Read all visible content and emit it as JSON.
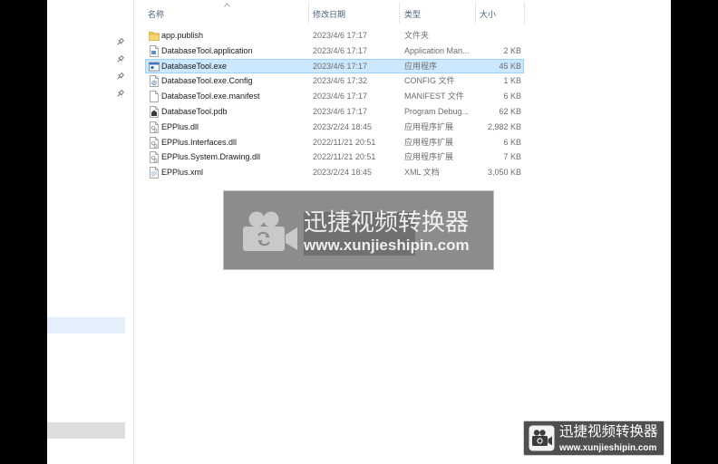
{
  "theme": {
    "selection-fill": "#cce8ff",
    "selection-border": "#99d1ff",
    "header-text": "#4c607a",
    "nav-highlight": "#e3f0fb",
    "nav-scroll-band": "#dedede"
  },
  "nav_pane": {
    "pins": [
      {
        "icon": "pin-icon"
      },
      {
        "icon": "pin-icon"
      },
      {
        "icon": "pin-icon"
      },
      {
        "icon": "pin-icon"
      }
    ]
  },
  "file_list": {
    "columns": {
      "name": "名称",
      "modified": "修改日期",
      "type": "类型",
      "size": "大小"
    },
    "sort_icon": "sort-ascending-icon",
    "files": [
      {
        "name": "app.publish",
        "modified": "2023/4/6 17:17",
        "type": "文件夹",
        "icon": "folder-icon"
      },
      {
        "name": "DatabaseTool.application",
        "modified": "2023/4/6 17:17",
        "type": "Application Man...",
        "size": "2 KB",
        "icon": "application-file-icon"
      },
      {
        "name": "DatabaseTool.exe",
        "modified": "2023/4/6 17:17",
        "type": "应用程序",
        "size": "45 KB",
        "icon": "exe-icon",
        "selected": true
      },
      {
        "name": "DatabaseTool.exe.Config",
        "modified": "2023/4/6 17:32",
        "type": "CONFIG 文件",
        "size": "1 KB",
        "icon": "config-file-icon"
      },
      {
        "name": "DatabaseTool.exe.manifest",
        "modified": "2023/4/6 17:17",
        "type": "MANIFEST 文件",
        "size": "6 KB",
        "icon": "manifest-file-icon"
      },
      {
        "name": "DatabaseTool.pdb",
        "modified": "2023/4/6 17:17",
        "type": "Program Debug...",
        "size": "62 KB",
        "icon": "pdb-file-icon"
      },
      {
        "name": "EPPlus.dll",
        "modified": "2023/2/24 18:45",
        "type": "应用程序扩展",
        "size": "2,982 KB",
        "icon": "dll-file-icon"
      },
      {
        "name": "EPPlus.Interfaces.dll",
        "modified": "2022/11/21 20:51",
        "type": "应用程序扩展",
        "size": "6 KB",
        "icon": "dll-file-icon"
      },
      {
        "name": "EPPlus.System.Drawing.dll",
        "modified": "2022/11/21 20:51",
        "type": "应用程序扩展",
        "size": "7 KB",
        "icon": "dll-file-icon"
      },
      {
        "name": "EPPlus.xml",
        "modified": "2023/2/24 18:45",
        "type": "XML 文档",
        "size": "3,050 KB",
        "icon": "xml-file-icon"
      }
    ]
  },
  "watermark": {
    "title": "迅捷视频转换器",
    "url": "www.xunjieshipin.com",
    "icon": "video-camera-icon"
  },
  "corner_logo": {
    "title": "迅捷视频转换器",
    "url": "www.xunjieshipin.com",
    "icon": "video-camera-icon"
  }
}
